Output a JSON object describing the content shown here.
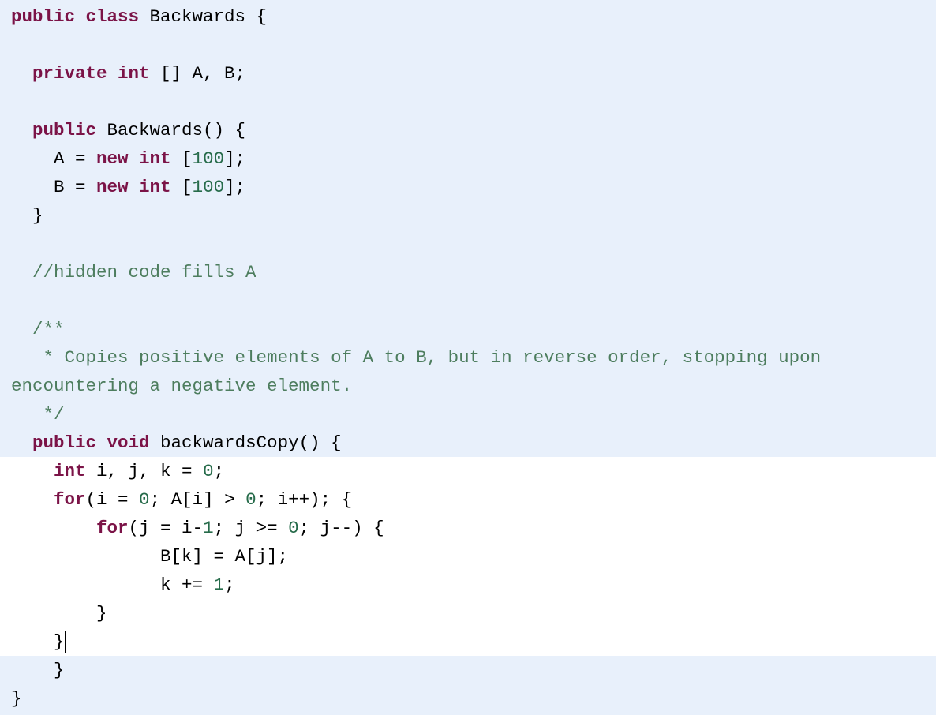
{
  "editor": {
    "colors": {
      "background_readonly": "#e8f0fb",
      "background_editable": "#ffffff",
      "keyword": "#7b1347",
      "number": "#266b4a",
      "comment": "#4d7d5e",
      "text": "#000000"
    },
    "editable_region": {
      "first_line": 16,
      "last_line": 22
    },
    "cursor": {
      "line": 22,
      "after": "}"
    },
    "lines": [
      [
        {
          "t": "kw",
          "v": "public class"
        },
        {
          "t": "tx",
          "v": " Backwards {"
        }
      ],
      [],
      [
        {
          "t": "tx",
          "v": "  "
        },
        {
          "t": "kw",
          "v": "private int"
        },
        {
          "t": "tx",
          "v": " [] A, B;"
        }
      ],
      [],
      [
        {
          "t": "tx",
          "v": "  "
        },
        {
          "t": "kw",
          "v": "public"
        },
        {
          "t": "tx",
          "v": " Backwards() {"
        }
      ],
      [
        {
          "t": "tx",
          "v": "    A = "
        },
        {
          "t": "kw",
          "v": "new int"
        },
        {
          "t": "tx",
          "v": " ["
        },
        {
          "t": "num",
          "v": "100"
        },
        {
          "t": "tx",
          "v": "];"
        }
      ],
      [
        {
          "t": "tx",
          "v": "    B = "
        },
        {
          "t": "kw",
          "v": "new int"
        },
        {
          "t": "tx",
          "v": " ["
        },
        {
          "t": "num",
          "v": "100"
        },
        {
          "t": "tx",
          "v": "];"
        }
      ],
      [
        {
          "t": "tx",
          "v": "  }"
        }
      ],
      [],
      [
        {
          "t": "tx",
          "v": "  "
        },
        {
          "t": "cm",
          "v": "//hidden code fills A"
        }
      ],
      [],
      [
        {
          "t": "tx",
          "v": "  "
        },
        {
          "t": "cm",
          "v": "/**"
        }
      ],
      [
        {
          "t": "tx",
          "v": "   "
        },
        {
          "t": "cm",
          "v": "* Copies positive elements of A to B, but in reverse order, stopping upon"
        }
      ],
      [
        {
          "t": "cm",
          "v": "encountering a negative element."
        }
      ],
      [
        {
          "t": "tx",
          "v": "   "
        },
        {
          "t": "cm",
          "v": "*/"
        }
      ],
      [
        {
          "t": "tx",
          "v": "  "
        },
        {
          "t": "kw",
          "v": "public void"
        },
        {
          "t": "tx",
          "v": " backwardsCopy() {"
        }
      ],
      [
        {
          "t": "tx",
          "v": "    "
        },
        {
          "t": "kw",
          "v": "int"
        },
        {
          "t": "tx",
          "v": " i, j, k = "
        },
        {
          "t": "num",
          "v": "0"
        },
        {
          "t": "tx",
          "v": ";"
        }
      ],
      [
        {
          "t": "tx",
          "v": "    "
        },
        {
          "t": "kw",
          "v": "for"
        },
        {
          "t": "tx",
          "v": "(i = "
        },
        {
          "t": "num",
          "v": "0"
        },
        {
          "t": "tx",
          "v": "; A[i] > "
        },
        {
          "t": "num",
          "v": "0"
        },
        {
          "t": "tx",
          "v": "; i++); {"
        }
      ],
      [
        {
          "t": "tx",
          "v": "        "
        },
        {
          "t": "kw",
          "v": "for"
        },
        {
          "t": "tx",
          "v": "(j = i-"
        },
        {
          "t": "num",
          "v": "1"
        },
        {
          "t": "tx",
          "v": "; j >= "
        },
        {
          "t": "num",
          "v": "0"
        },
        {
          "t": "tx",
          "v": "; j--) {"
        }
      ],
      [
        {
          "t": "tx",
          "v": "              B[k] = A[j];"
        }
      ],
      [
        {
          "t": "tx",
          "v": "              k += "
        },
        {
          "t": "num",
          "v": "1"
        },
        {
          "t": "tx",
          "v": ";"
        }
      ],
      [
        {
          "t": "tx",
          "v": "        }"
        }
      ],
      [
        {
          "t": "tx",
          "v": "    }"
        }
      ],
      [
        {
          "t": "tx",
          "v": "    }"
        }
      ],
      [
        {
          "t": "tx",
          "v": "}"
        }
      ]
    ]
  }
}
